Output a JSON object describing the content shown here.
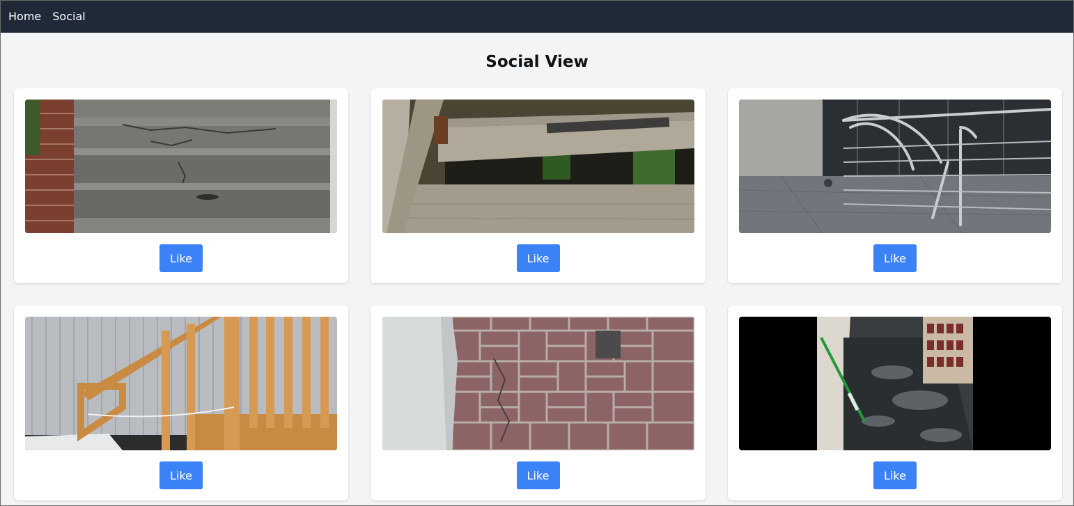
{
  "nav": {
    "links": [
      {
        "label": "Home"
      },
      {
        "label": "Social"
      }
    ]
  },
  "page": {
    "title": "Social View"
  },
  "posts": [
    {
      "photo": "cracked-concrete-stairs",
      "like_label": "Like"
    },
    {
      "photo": "broken-wooden-stair-tread",
      "like_label": "Like"
    },
    {
      "photo": "bent-metal-railing",
      "like_label": "Like"
    },
    {
      "photo": "wooden-stair-railing",
      "like_label": "Like"
    },
    {
      "photo": "cracked-brick-paving",
      "like_label": "Like"
    },
    {
      "photo": "wet-store-floor",
      "like_label": "Like"
    }
  ],
  "colors": {
    "navbar": "#1f2937",
    "page_background": "#f3f4f6",
    "button": "#3b82f6"
  }
}
